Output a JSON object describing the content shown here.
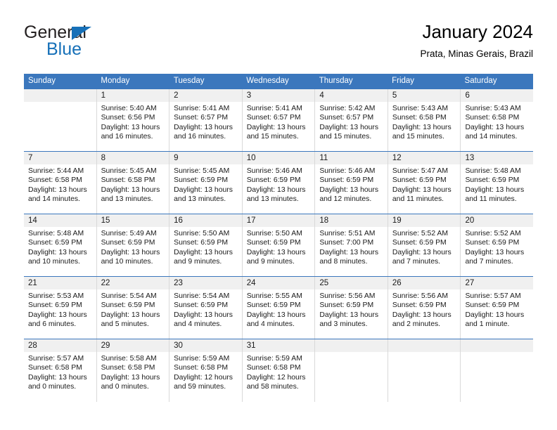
{
  "brand": {
    "name_top": "General",
    "name_bottom": "Blue",
    "triangle_color": "#1670b8",
    "text_color": "#231f20"
  },
  "header": {
    "title": "January 2024",
    "subtitle": "Prata, Minas Gerais, Brazil"
  },
  "theme": {
    "header_blue": "#3b77bd",
    "day_band_gray": "#f0f0f0",
    "grid_line": "#d9d9d9"
  },
  "calendar": {
    "weekdays": [
      "Sunday",
      "Monday",
      "Tuesday",
      "Wednesday",
      "Thursday",
      "Friday",
      "Saturday"
    ],
    "weeks": [
      [
        {
          "day": "",
          "lines": []
        },
        {
          "day": "1",
          "lines": [
            "Sunrise: 5:40 AM",
            "Sunset: 6:56 PM",
            "Daylight: 13 hours",
            "and 16 minutes."
          ]
        },
        {
          "day": "2",
          "lines": [
            "Sunrise: 5:41 AM",
            "Sunset: 6:57 PM",
            "Daylight: 13 hours",
            "and 16 minutes."
          ]
        },
        {
          "day": "3",
          "lines": [
            "Sunrise: 5:41 AM",
            "Sunset: 6:57 PM",
            "Daylight: 13 hours",
            "and 15 minutes."
          ]
        },
        {
          "day": "4",
          "lines": [
            "Sunrise: 5:42 AM",
            "Sunset: 6:57 PM",
            "Daylight: 13 hours",
            "and 15 minutes."
          ]
        },
        {
          "day": "5",
          "lines": [
            "Sunrise: 5:43 AM",
            "Sunset: 6:58 PM",
            "Daylight: 13 hours",
            "and 15 minutes."
          ]
        },
        {
          "day": "6",
          "lines": [
            "Sunrise: 5:43 AM",
            "Sunset: 6:58 PM",
            "Daylight: 13 hours",
            "and 14 minutes."
          ]
        }
      ],
      [
        {
          "day": "7",
          "lines": [
            "Sunrise: 5:44 AM",
            "Sunset: 6:58 PM",
            "Daylight: 13 hours",
            "and 14 minutes."
          ]
        },
        {
          "day": "8",
          "lines": [
            "Sunrise: 5:45 AM",
            "Sunset: 6:58 PM",
            "Daylight: 13 hours",
            "and 13 minutes."
          ]
        },
        {
          "day": "9",
          "lines": [
            "Sunrise: 5:45 AM",
            "Sunset: 6:59 PM",
            "Daylight: 13 hours",
            "and 13 minutes."
          ]
        },
        {
          "day": "10",
          "lines": [
            "Sunrise: 5:46 AM",
            "Sunset: 6:59 PM",
            "Daylight: 13 hours",
            "and 13 minutes."
          ]
        },
        {
          "day": "11",
          "lines": [
            "Sunrise: 5:46 AM",
            "Sunset: 6:59 PM",
            "Daylight: 13 hours",
            "and 12 minutes."
          ]
        },
        {
          "day": "12",
          "lines": [
            "Sunrise: 5:47 AM",
            "Sunset: 6:59 PM",
            "Daylight: 13 hours",
            "and 11 minutes."
          ]
        },
        {
          "day": "13",
          "lines": [
            "Sunrise: 5:48 AM",
            "Sunset: 6:59 PM",
            "Daylight: 13 hours",
            "and 11 minutes."
          ]
        }
      ],
      [
        {
          "day": "14",
          "lines": [
            "Sunrise: 5:48 AM",
            "Sunset: 6:59 PM",
            "Daylight: 13 hours",
            "and 10 minutes."
          ]
        },
        {
          "day": "15",
          "lines": [
            "Sunrise: 5:49 AM",
            "Sunset: 6:59 PM",
            "Daylight: 13 hours",
            "and 10 minutes."
          ]
        },
        {
          "day": "16",
          "lines": [
            "Sunrise: 5:50 AM",
            "Sunset: 6:59 PM",
            "Daylight: 13 hours",
            "and 9 minutes."
          ]
        },
        {
          "day": "17",
          "lines": [
            "Sunrise: 5:50 AM",
            "Sunset: 6:59 PM",
            "Daylight: 13 hours",
            "and 9 minutes."
          ]
        },
        {
          "day": "18",
          "lines": [
            "Sunrise: 5:51 AM",
            "Sunset: 7:00 PM",
            "Daylight: 13 hours",
            "and 8 minutes."
          ]
        },
        {
          "day": "19",
          "lines": [
            "Sunrise: 5:52 AM",
            "Sunset: 6:59 PM",
            "Daylight: 13 hours",
            "and 7 minutes."
          ]
        },
        {
          "day": "20",
          "lines": [
            "Sunrise: 5:52 AM",
            "Sunset: 6:59 PM",
            "Daylight: 13 hours",
            "and 7 minutes."
          ]
        }
      ],
      [
        {
          "day": "21",
          "lines": [
            "Sunrise: 5:53 AM",
            "Sunset: 6:59 PM",
            "Daylight: 13 hours",
            "and 6 minutes."
          ]
        },
        {
          "day": "22",
          "lines": [
            "Sunrise: 5:54 AM",
            "Sunset: 6:59 PM",
            "Daylight: 13 hours",
            "and 5 minutes."
          ]
        },
        {
          "day": "23",
          "lines": [
            "Sunrise: 5:54 AM",
            "Sunset: 6:59 PM",
            "Daylight: 13 hours",
            "and 4 minutes."
          ]
        },
        {
          "day": "24",
          "lines": [
            "Sunrise: 5:55 AM",
            "Sunset: 6:59 PM",
            "Daylight: 13 hours",
            "and 4 minutes."
          ]
        },
        {
          "day": "25",
          "lines": [
            "Sunrise: 5:56 AM",
            "Sunset: 6:59 PM",
            "Daylight: 13 hours",
            "and 3 minutes."
          ]
        },
        {
          "day": "26",
          "lines": [
            "Sunrise: 5:56 AM",
            "Sunset: 6:59 PM",
            "Daylight: 13 hours",
            "and 2 minutes."
          ]
        },
        {
          "day": "27",
          "lines": [
            "Sunrise: 5:57 AM",
            "Sunset: 6:59 PM",
            "Daylight: 13 hours",
            "and 1 minute."
          ]
        }
      ],
      [
        {
          "day": "28",
          "lines": [
            "Sunrise: 5:57 AM",
            "Sunset: 6:58 PM",
            "Daylight: 13 hours",
            "and 0 minutes."
          ]
        },
        {
          "day": "29",
          "lines": [
            "Sunrise: 5:58 AM",
            "Sunset: 6:58 PM",
            "Daylight: 13 hours",
            "and 0 minutes."
          ]
        },
        {
          "day": "30",
          "lines": [
            "Sunrise: 5:59 AM",
            "Sunset: 6:58 PM",
            "Daylight: 12 hours",
            "and 59 minutes."
          ]
        },
        {
          "day": "31",
          "lines": [
            "Sunrise: 5:59 AM",
            "Sunset: 6:58 PM",
            "Daylight: 12 hours",
            "and 58 minutes."
          ]
        },
        {
          "day": "",
          "lines": []
        },
        {
          "day": "",
          "lines": []
        },
        {
          "day": "",
          "lines": []
        }
      ]
    ]
  }
}
